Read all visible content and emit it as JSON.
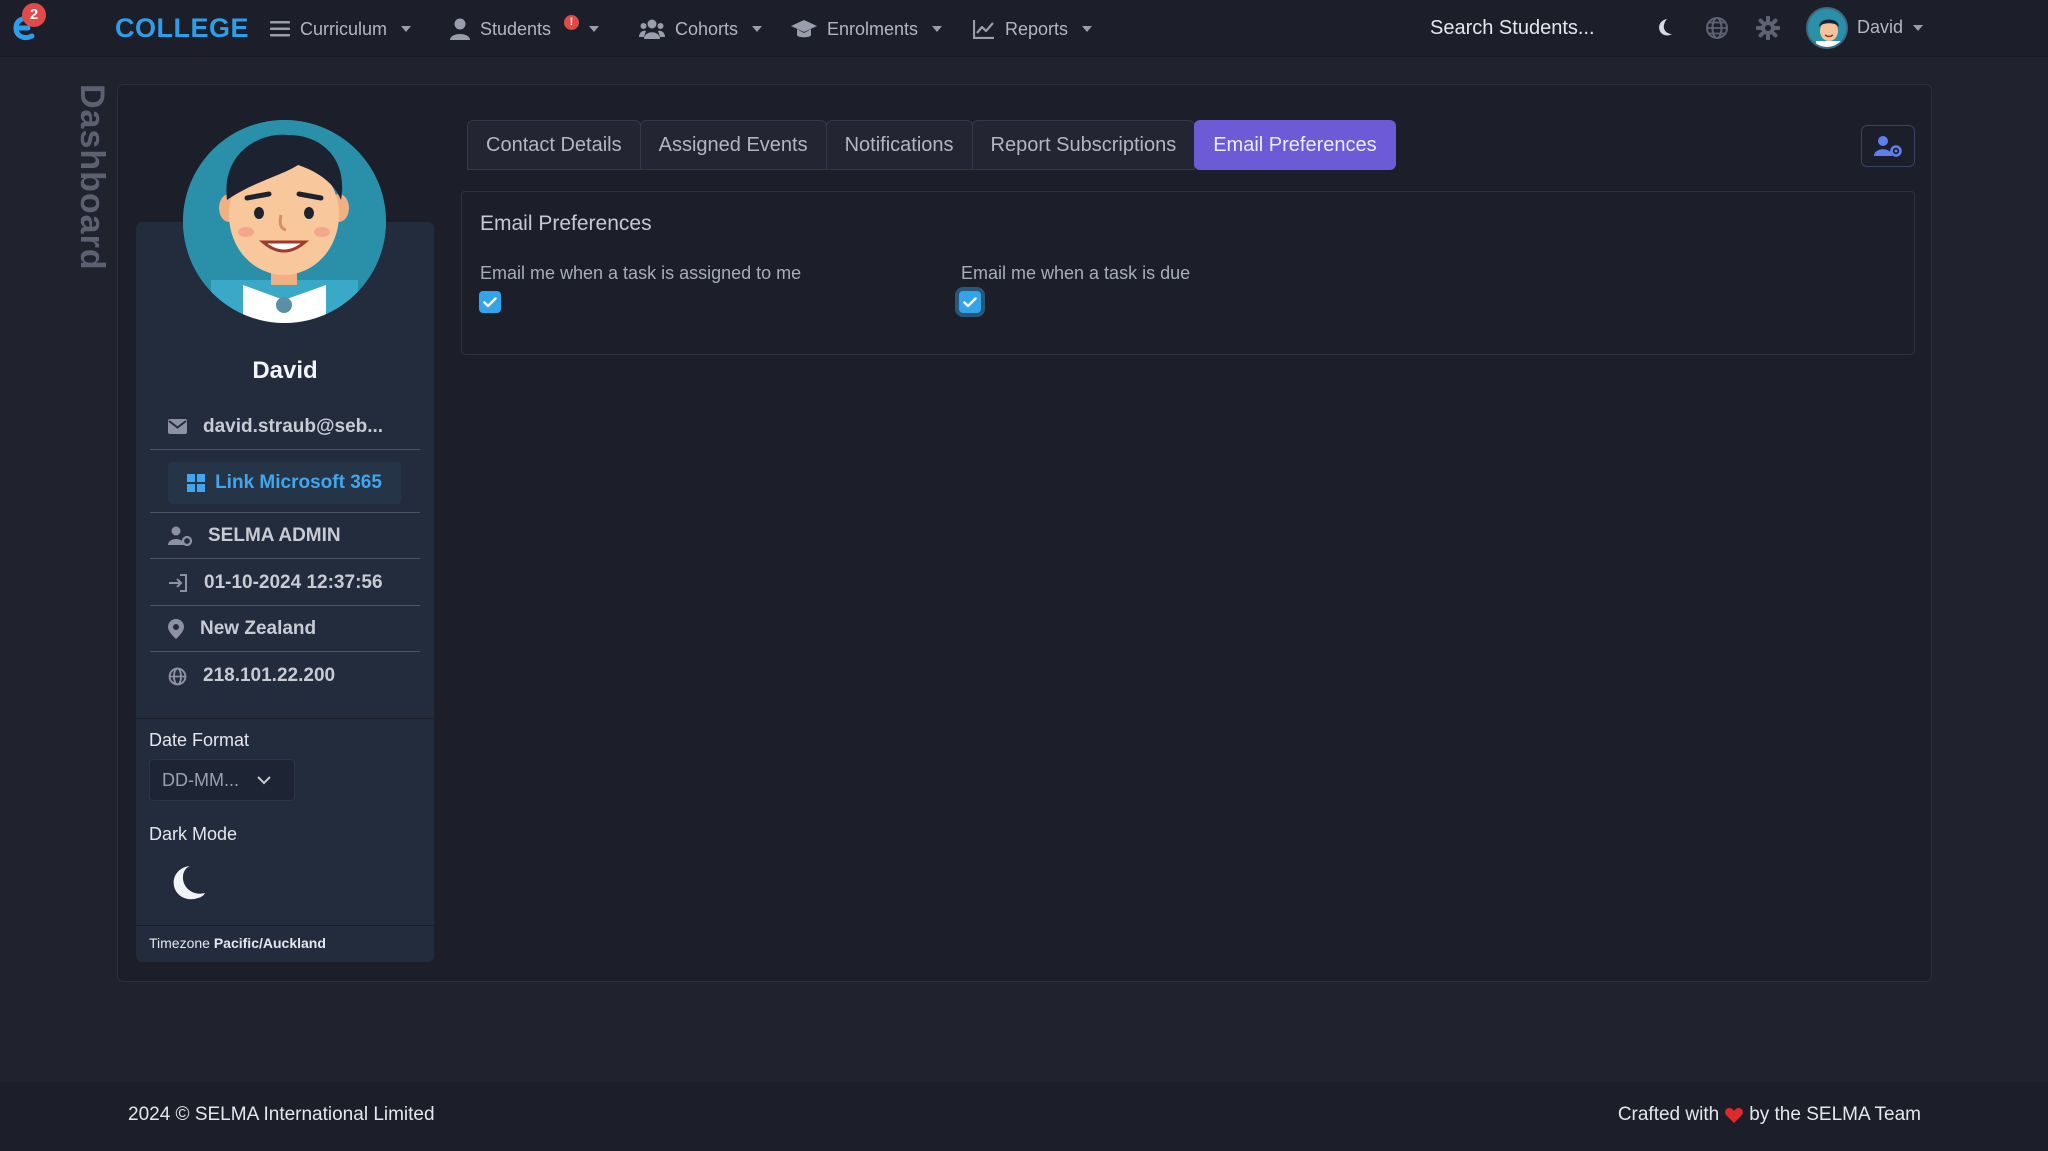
{
  "app": {
    "brand": "COLLEGE",
    "notification_count": "2"
  },
  "nav": {
    "items": [
      {
        "label": "Curriculum",
        "icon": "hamburger-icon"
      },
      {
        "label": "Students",
        "icon": "user-icon",
        "alert": "!"
      },
      {
        "label": "Cohorts",
        "icon": "users-icon"
      },
      {
        "label": "Enrolments",
        "icon": "graduation-cap-icon"
      },
      {
        "label": "Reports",
        "icon": "chart-line-icon"
      }
    ],
    "search_placeholder": "Search Students...",
    "user_name": "David"
  },
  "sidebar": {
    "vertical_label": "Dashboard"
  },
  "profile": {
    "name": "David",
    "email": "david.straub@seb...",
    "ms_button_label": "Link Microsoft 365",
    "role": "SELMA ADMIN",
    "last_login": "01-10-2024 12:37:56",
    "location": "New Zealand",
    "ip": "218.101.22.200",
    "date_format_label": "Date Format",
    "date_format_value": "DD-MM...",
    "dark_mode_label": "Dark Mode",
    "timezone_label": "Timezone",
    "timezone_value": "Pacific/Auckland"
  },
  "tabs": [
    {
      "label": "Contact Details",
      "active": false
    },
    {
      "label": "Assigned Events",
      "active": false
    },
    {
      "label": "Notifications",
      "active": false
    },
    {
      "label": "Report Subscriptions",
      "active": false
    },
    {
      "label": "Email Preferences",
      "active": true
    }
  ],
  "email_preferences": {
    "title": "Email Preferences",
    "options": [
      {
        "label": "Email me when a task is assigned to me",
        "checked": true
      },
      {
        "label": "Email me when a task is due",
        "checked": true
      }
    ]
  },
  "footer": {
    "copyright": "2024 © SELMA International Limited",
    "crafted_prefix": "Crafted with",
    "crafted_suffix": "by the SELMA Team"
  },
  "colors": {
    "accent": "#6c5ad6",
    "brand": "#2f9ee8",
    "checkbox": "#33a3ea",
    "badge": "#e24a4a",
    "heart": "#e02a2a"
  }
}
